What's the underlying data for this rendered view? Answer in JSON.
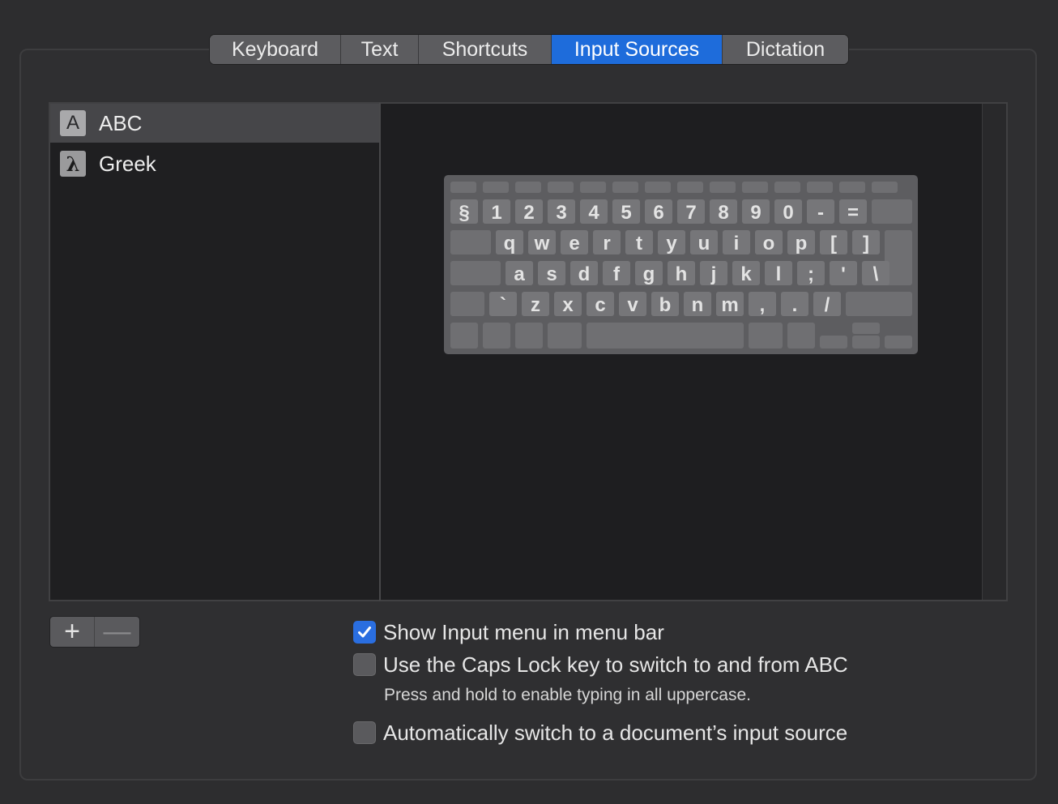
{
  "tabs": [
    {
      "label": "Keyboard",
      "active": false
    },
    {
      "label": "Text",
      "active": false
    },
    {
      "label": "Shortcuts",
      "active": false
    },
    {
      "label": "Input Sources",
      "active": true
    },
    {
      "label": "Dictation",
      "active": false
    }
  ],
  "input_sources": [
    {
      "icon_glyph": "A",
      "label": "ABC",
      "selected": true,
      "icon": "abc-icon"
    },
    {
      "icon_glyph": "λ",
      "label": "Greek",
      "selected": false,
      "icon": "greek-lambda-icon"
    }
  ],
  "keyboard_preview": {
    "rows": [
      [
        "§",
        "1",
        "2",
        "3",
        "4",
        "5",
        "6",
        "7",
        "8",
        "9",
        "0",
        "-",
        "="
      ],
      [
        "q",
        "w",
        "e",
        "r",
        "t",
        "y",
        "u",
        "i",
        "o",
        "p",
        "[",
        "]"
      ],
      [
        "a",
        "s",
        "d",
        "f",
        "g",
        "h",
        "j",
        "k",
        "l",
        ";",
        "'",
        "\\"
      ],
      [
        "`",
        "z",
        "x",
        "c",
        "v",
        "b",
        "n",
        "m",
        ",",
        ".",
        "/"
      ]
    ]
  },
  "buttons": {
    "add_label": "+",
    "remove_label": "—"
  },
  "options": [
    {
      "label": "Show Input menu in menu bar",
      "checked": true
    },
    {
      "label": "Use the Caps Lock key to switch to and from ABC",
      "checked": false
    },
    {
      "label": "Automatically switch to a document’s input source",
      "checked": false
    }
  ],
  "caps_lock_hint": "Press and hold to enable typing in all uppercase.",
  "colors": {
    "accent": "#1e6cdb",
    "checkbox_checked": "#2a6ee0",
    "window_background": "#2d2d2f"
  }
}
